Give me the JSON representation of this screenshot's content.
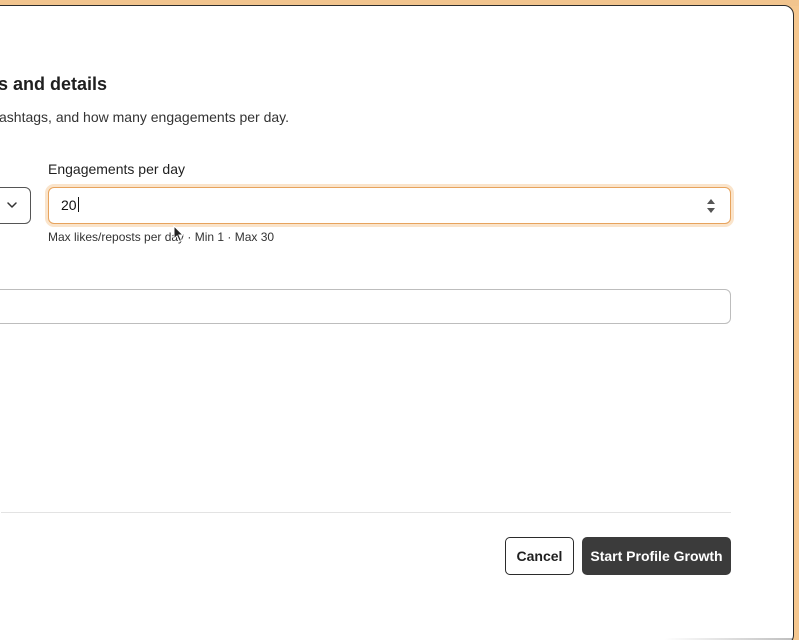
{
  "section": {
    "title": "mits and details",
    "subtitle": "ashtags, and how many engagements per day."
  },
  "engagements": {
    "label": "Engagements per day",
    "value": "20",
    "hint": "Max likes/reposts per day · Min 1 · Max 30"
  },
  "footer": {
    "cancel_label": "Cancel",
    "primary_label": "Start Profile Growth"
  },
  "icons": {
    "select_chevron": "chevron-down-icon",
    "spinner": "spinner-arrows-icon",
    "cursor": "mouse-pointer-icon"
  },
  "colors": {
    "accent_focus": "#e7a35d",
    "primary_button": "#3b3b3b",
    "backdrop": "#f5c78f"
  }
}
